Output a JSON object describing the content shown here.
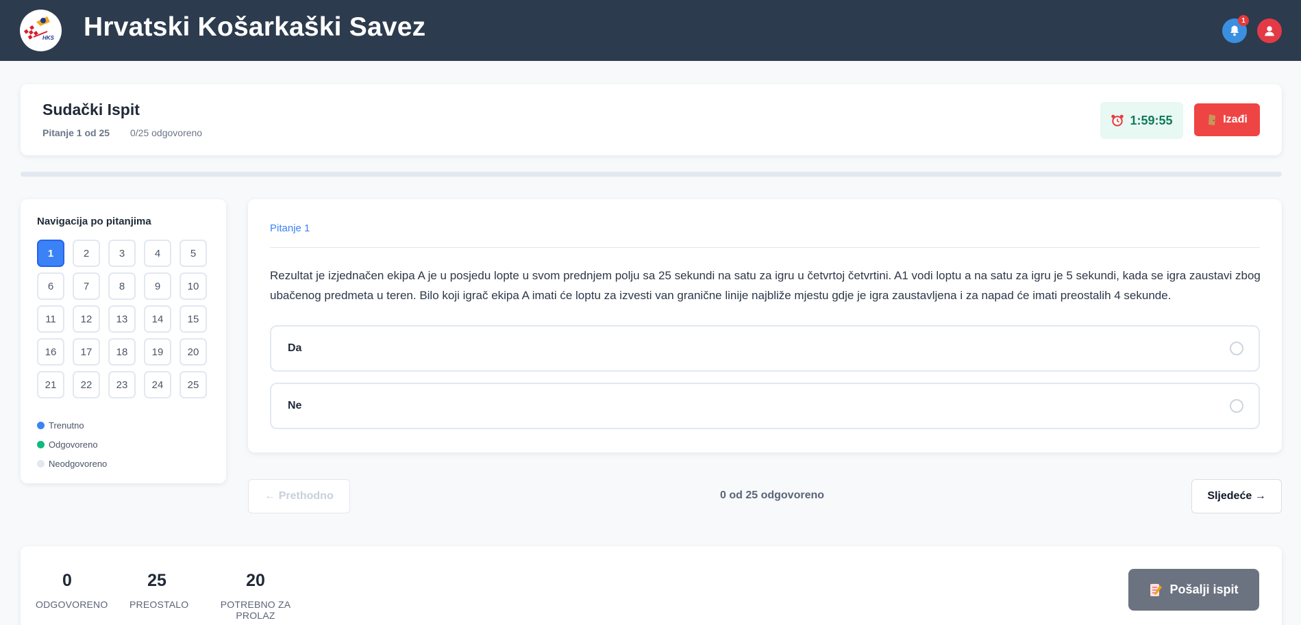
{
  "header": {
    "logo_text": "HKS",
    "title": "Hrvatski Košarkaški Savez",
    "notification_count": "1",
    "colors": {
      "bar": "#2d3b4e",
      "bell": "#3b8fe0",
      "user": "#e33a46"
    }
  },
  "exam": {
    "title": "Sudački Ispit",
    "question_position": "Pitanje 1 od 25",
    "answered_summary": "0/25 odgovoreno",
    "timer": "1:59:55",
    "exit_label": "Izađi",
    "progress_fraction": 0
  },
  "navigation": {
    "title": "Navigacija po pitanjima",
    "current": 1,
    "questions": [
      "1",
      "2",
      "3",
      "4",
      "5",
      "6",
      "7",
      "8",
      "9",
      "10",
      "11",
      "12",
      "13",
      "14",
      "15",
      "16",
      "17",
      "18",
      "19",
      "20",
      "21",
      "22",
      "23",
      "24",
      "25"
    ],
    "legend": [
      {
        "label": "Trenutno",
        "color": "#3b82f6"
      },
      {
        "label": "Odgovoreno",
        "color": "#10b981"
      },
      {
        "label": "Neodgovoreno",
        "color": "#e2e8f0"
      }
    ]
  },
  "question": {
    "label": "Pitanje 1",
    "text": "Rezultat je izjednačen ekipa A je u posjedu lopte u svom prednjem polju sa 25 sekundi na satu za igru u četvrtoj četvrtini. A1 vodi loptu a na satu za igru je 5 sekundi, kada se igra zaustavi zbog ubačenog predmeta u teren. Bilo koji igrač ekipa A imati će loptu za izvesti van granične linije najbliže mjestu gdje je igra zaustavljena i za napad će imati preostalih 4 sekunde.",
    "options": [
      {
        "label": "Da"
      },
      {
        "label": "Ne"
      }
    ]
  },
  "pager": {
    "prev_label": "← Prethodno",
    "answered_label": "0 od 25 odgovoreno",
    "next_label": "Sljedeće →"
  },
  "stats": [
    {
      "value": "0",
      "label": "ODGOVORENO"
    },
    {
      "value": "25",
      "label": "PREOSTALO"
    },
    {
      "value": "20",
      "label": "POTREBNO ZA PROLAZ"
    }
  ],
  "submit_label": "Pošalji ispit"
}
